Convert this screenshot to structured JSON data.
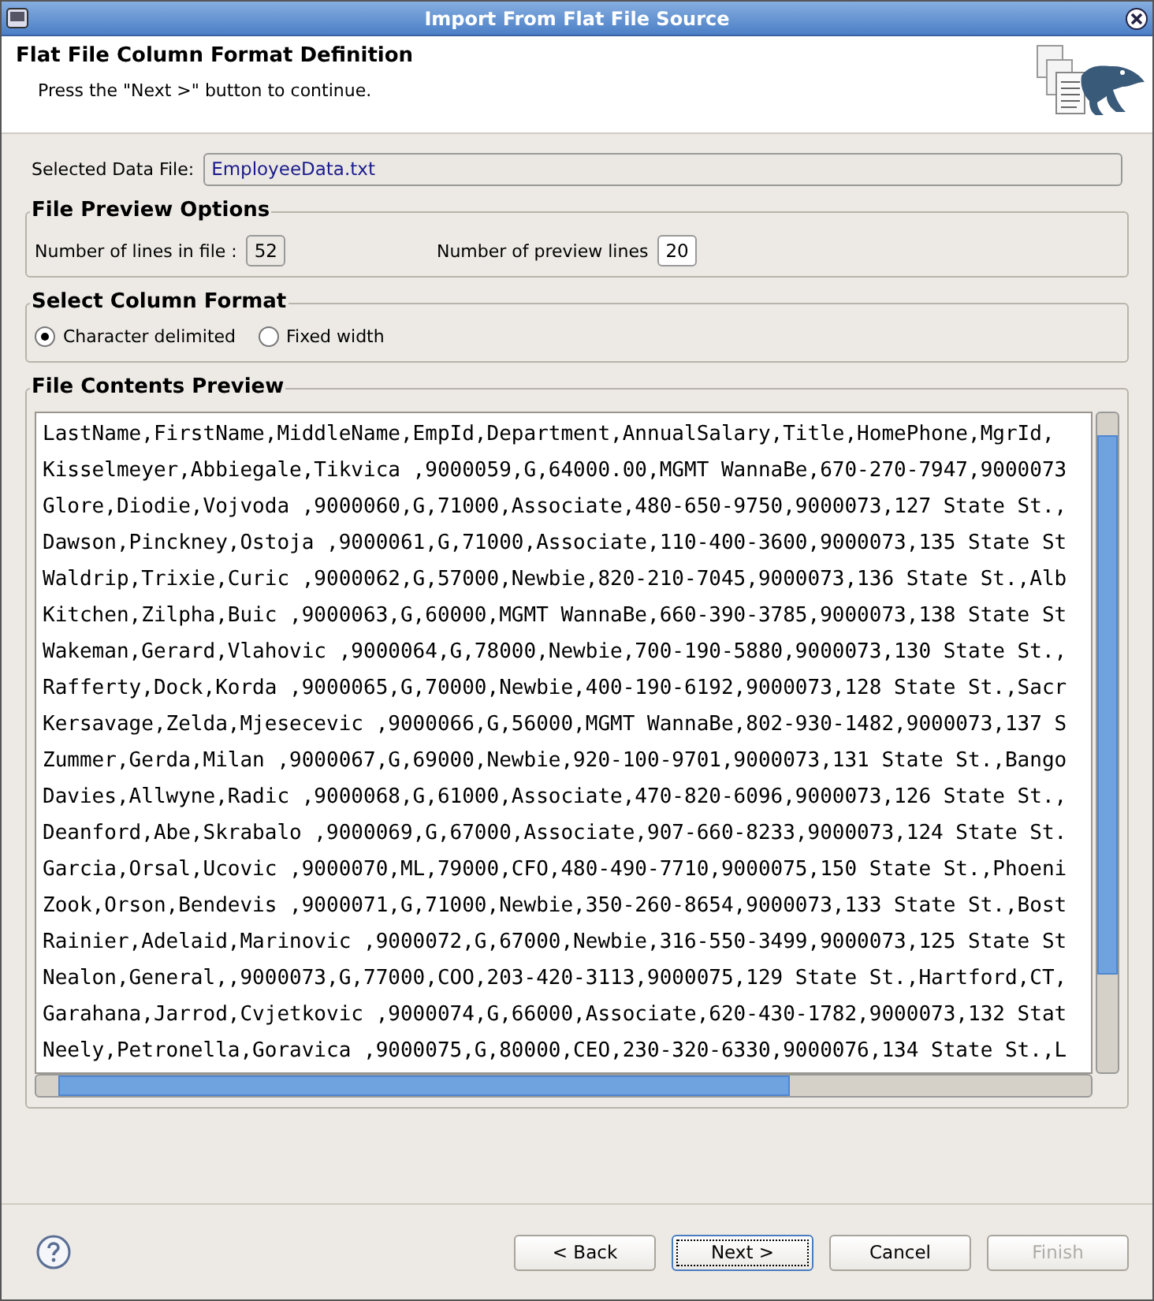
{
  "window": {
    "title": "Import From Flat File Source"
  },
  "header": {
    "title": "Flat File Column Format Definition",
    "subtitle": "Press the \"Next >\" button to continue."
  },
  "data_file": {
    "label": "Selected Data File:",
    "value": "EmployeeData.txt"
  },
  "preview_options": {
    "title": "File Preview Options",
    "lines_in_file_label": "Number of lines in file :",
    "lines_in_file": "52",
    "preview_lines_label": "Number of preview lines",
    "preview_lines": "20"
  },
  "column_format": {
    "title": "Select Column Format",
    "options": [
      {
        "label": "Character delimited",
        "selected": true
      },
      {
        "label": "Fixed width",
        "selected": false
      }
    ]
  },
  "preview": {
    "title": "File Contents Preview",
    "lines": [
      "LastName,FirstName,MiddleName,EmpId,Department,AnnualSalary,Title,HomePhone,MgrId,",
      "Kisselmeyer,Abbiegale,Tikvica ,9000059,G,64000.00,MGMT WannaBe,670-270-7947,9000073",
      "Glore,Diodie,Vojvoda ,9000060,G,71000,Associate,480-650-9750,9000073,127 State St.,",
      "Dawson,Pinckney,Ostoja ,9000061,G,71000,Associate,110-400-3600,9000073,135 State St",
      "Waldrip,Trixie,Curic ,9000062,G,57000,Newbie,820-210-7045,9000073,136 State St.,Alb",
      "Kitchen,Zilpha,Buic ,9000063,G,60000,MGMT WannaBe,660-390-3785,9000073,138 State St",
      "Wakeman,Gerard,Vlahovic ,9000064,G,78000,Newbie,700-190-5880,9000073,130 State St.,",
      "Rafferty,Dock,Korda ,9000065,G,70000,Newbie,400-190-6192,9000073,128 State St.,Sacr",
      "Kersavage,Zelda,Mjesecevic ,9000066,G,56000,MGMT WannaBe,802-930-1482,9000073,137 S",
      "Zummer,Gerda,Milan ,9000067,G,69000,Newbie,920-100-9701,9000073,131 State St.,Bango",
      "Davies,Allwyne,Radic ,9000068,G,61000,Associate,470-820-6096,9000073,126 State St.,",
      "Deanford,Abe,Skrabalo ,9000069,G,67000,Associate,907-660-8233,9000073,124 State St.",
      "Garcia,Orsal,Ucovic ,9000070,ML,79000,CFO,480-490-7710,9000075,150 State St.,Phoeni",
      "Zook,Orson,Bendevis ,9000071,G,71000,Newbie,350-260-8654,9000073,133 State St.,Bost",
      "Rainier,Adelaid,Marinovic ,9000072,G,67000,Newbie,316-550-3499,9000073,125 State St",
      "Nealon,General,,9000073,G,77000,COO,203-420-3113,9000075,129 State St.,Hartford,CT,",
      "Garahana,Jarrod,Cvjetkovic ,9000074,G,66000,Associate,620-430-1782,9000073,132 Stat",
      "Neely,Petronella,Goravica ,9000075,G,80000,CEO,230-320-6330,9000076,134 State St.,L"
    ]
  },
  "buttons": [
    {
      "label": "< Back",
      "disabled": false,
      "focused": false
    },
    {
      "label": "Next >",
      "disabled": false,
      "focused": true
    },
    {
      "label": "Cancel",
      "disabled": false,
      "focused": false
    },
    {
      "label": "Finish",
      "disabled": true,
      "focused": false
    }
  ]
}
